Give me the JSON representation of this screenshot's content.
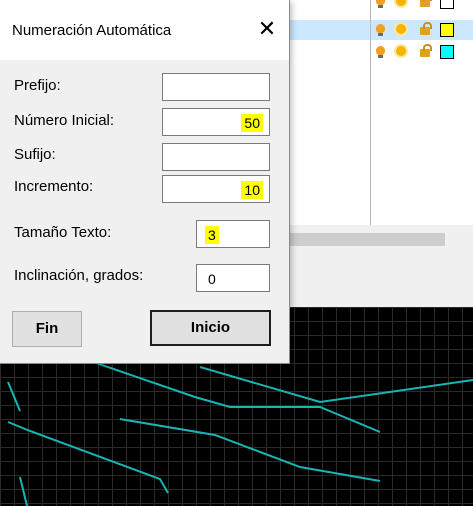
{
  "dialog": {
    "title": "Numeración Automática",
    "close_label": "✕",
    "fields": {
      "prefijo": {
        "label": "Prefijo:",
        "value": ""
      },
      "numero_inicial": {
        "label": "Número Inicial:",
        "value": "50"
      },
      "sufijo": {
        "label": "Sufijo:",
        "value": ""
      },
      "incremento": {
        "label": "Incremento:",
        "value": "10"
      },
      "tamano_texto": {
        "label": "Tamaño Texto:",
        "value": "3"
      },
      "inclinacion": {
        "label": "Inclinación, grados:",
        "value": "0"
      }
    },
    "buttons": {
      "fin": "Fin",
      "inicio": "Inicio"
    }
  },
  "layers": [
    {
      "icons": [
        "bulb-icon",
        "sun-icon",
        "lock-icon"
      ],
      "color": "#ffffff",
      "selected": false
    },
    {
      "icons": [
        "bulb-icon",
        "sun-icon",
        "lock-icon"
      ],
      "color": "#ffff00",
      "selected": true
    },
    {
      "icons": [
        "bulb-icon",
        "sun-icon",
        "lock-icon"
      ],
      "color": "#00ffff",
      "selected": false
    }
  ],
  "colors": {
    "highlight": "#ffff00",
    "canvas_bg": "#000000",
    "polyline": "#19b5b5"
  }
}
